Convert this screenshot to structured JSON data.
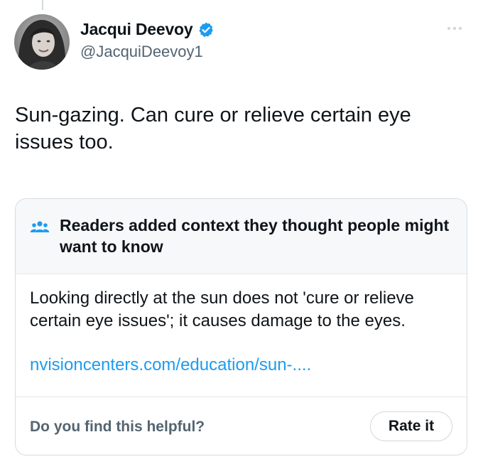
{
  "author": {
    "display_name": "Jacqui Deevoy",
    "handle": "@JacquiDeevoy1",
    "verified": true,
    "avatar_icon": "profile-photo"
  },
  "tweet": {
    "text": "Sun-gazing. Can cure or relieve certain eye\nissues too."
  },
  "community_note": {
    "header_icon": "readers-people-icon",
    "title": "Readers added context they thought people might want to know",
    "body": "Looking directly at the sun does not 'cure or relieve certain eye issues'; it causes damage to the eyes.",
    "link_text": "nvisioncenters.com/education/sun-....",
    "question": "Do you find this helpful?",
    "rate_button_label": "Rate it"
  },
  "colors": {
    "link": "#1d9bf0",
    "verified_badge": "#1d9bf0",
    "secondary_text": "#536471",
    "note_header_bg": "#f6f8f9"
  }
}
